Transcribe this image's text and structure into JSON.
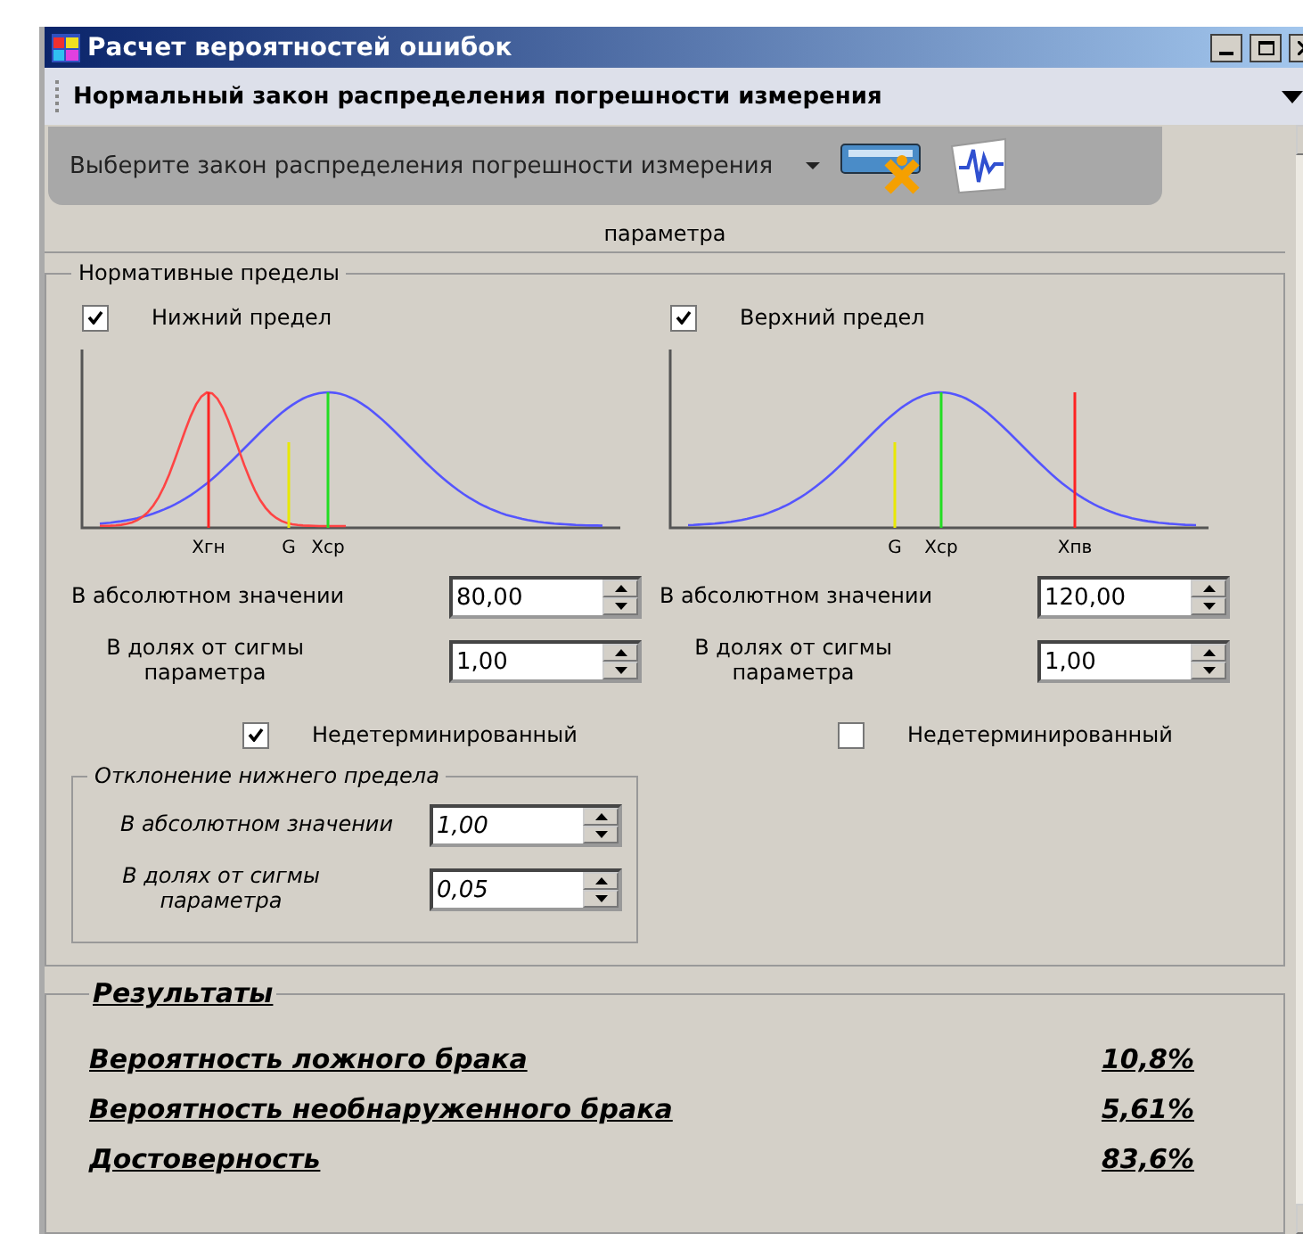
{
  "window": {
    "title": "Расчет вероятностей ошибок"
  },
  "toolbar": {
    "law": "Нормальный закон распределения погрешности измерения"
  },
  "popup": {
    "prompt": "Выберите закон распределения погрешности измерения"
  },
  "hidden_label": "параметра",
  "limits": {
    "title": "Нормативные пределы",
    "sides": [
      {
        "kind": "lower",
        "label": "Нижний предел",
        "checked": true,
        "markers": [
          "Xгн",
          "G",
          "Xср"
        ],
        "abs_label": "В абсолютном значении",
        "abs_value": "80,00",
        "sigma_label": "В долях от сигмы параметра",
        "sigma_value": "1,00",
        "indeterminate_label": "Недетерминированный",
        "indeterminate": true
      },
      {
        "kind": "upper",
        "label": "Верхний предел",
        "checked": true,
        "markers": [
          "G",
          "Xср",
          "Xпв"
        ],
        "abs_label": "В абсолютном значении",
        "abs_value": "120,00",
        "sigma_label": "В долях от сигмы параметра",
        "sigma_value": "1,00",
        "indeterminate_label": "Недетерминированный",
        "indeterminate": false
      }
    ]
  },
  "deviation": {
    "title": "Отклонение нижнего предела",
    "abs_label": "В абсолютном значении",
    "abs_value": "1,00",
    "sigma_label": "В долях от сигмы параметра",
    "sigma_value": "0,05"
  },
  "results": {
    "title": "Результаты",
    "rows": [
      {
        "label": "Вероятность ложного брака",
        "value": "10,8%"
      },
      {
        "label": "Вероятность необнаруженного брака",
        "value": "5,61%"
      },
      {
        "label": "Достоверность",
        "value": "83,6%"
      }
    ]
  }
}
